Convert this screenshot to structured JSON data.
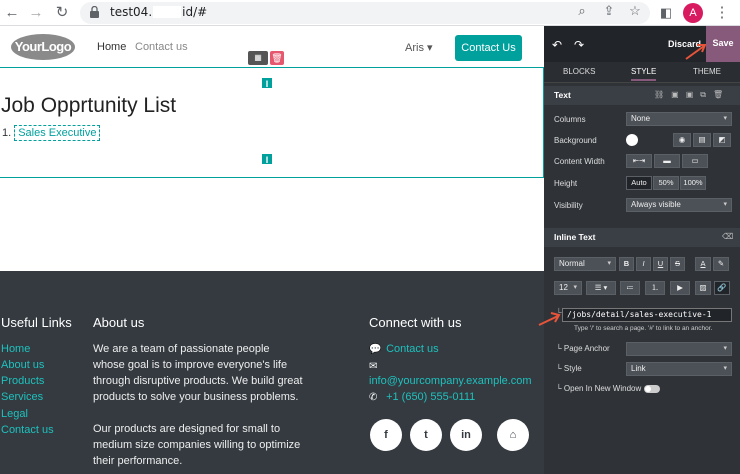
{
  "browser": {
    "url_prefix": "test04.",
    "url_suffix": "id/#",
    "avatar_letter": "A"
  },
  "site": {
    "logo": "YourLogo",
    "nav": {
      "home": "Home",
      "contact": "Contact us",
      "user": "Aris"
    },
    "contact_button": "Contact Us",
    "job_list_title": "Job Opprtunity List",
    "job_index": "1.",
    "job_link": "Sales Executive"
  },
  "footer": {
    "useful_links_title": "Useful Links",
    "links": [
      "Home",
      "About us",
      "Products",
      "Services",
      "Legal",
      "Contact us"
    ],
    "about_title": "About us",
    "about_p1": "We are a team of passionate people whose goal is to improve everyone's life through disruptive products. We build great products to solve your business problems.",
    "about_p2": "Our products are designed for small to medium size companies willing to optimize their performance.",
    "connect_title": "Connect with us",
    "contact_link": "Contact us",
    "email": "info@yourcompany.example.com",
    "phone": "+1 (650) 555-0111",
    "social": [
      "f",
      "t",
      "in",
      "⌂"
    ]
  },
  "panel": {
    "discard": "Discard",
    "save": "Save",
    "tabs": [
      "BLOCKS",
      "STYLE",
      "THEME"
    ],
    "text_section": "Text",
    "columns_label": "Columns",
    "columns_value": "None",
    "background_label": "Background",
    "content_width_label": "Content Width",
    "height_label": "Height",
    "height_options": [
      "Auto",
      "50%",
      "100%"
    ],
    "visibility_label": "Visibility",
    "visibility_value": "Always visible",
    "inline_text_section": "Inline Text",
    "font_style_value": "Normal",
    "font_size_value": "12",
    "link_url": "/jobs/detail/sales-executive-1",
    "link_hint": "Type '/' to search a page. '#' to link to an anchor.",
    "page_anchor_label": "Page Anchor",
    "style_label": "Style",
    "style_value": "Link",
    "new_window_label": "Open In New Window",
    "colors": {
      "accent": "#875a7b",
      "teal": "#00a09d"
    }
  }
}
